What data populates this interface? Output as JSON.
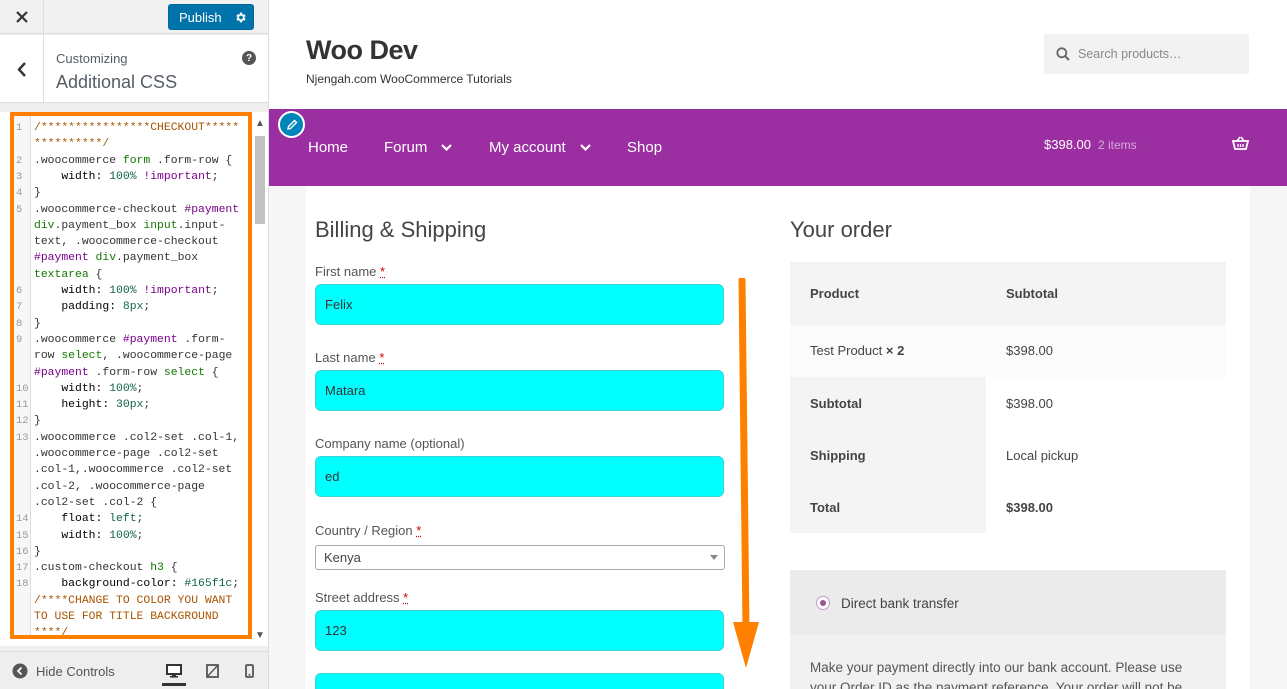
{
  "sidebar": {
    "publish_label": "Publish",
    "eyebrow": "Customizing",
    "title": "Additional CSS",
    "help": "?",
    "hide_controls": "Hide Controls",
    "code_lines": [
      {
        "n": "1",
        "parts": [
          [
            "c-com",
            "/****************CHECKOUT*****"
          ]
        ]
      },
      {
        "n": "",
        "parts": [
          [
            "c-com",
            "**********/"
          ]
        ]
      },
      {
        "n": "2",
        "parts": [
          [
            "",
            ".woocommerce "
          ],
          [
            "c-tag",
            "form"
          ],
          [
            "",
            " .form-row {"
          ]
        ]
      },
      {
        "n": "3",
        "parts": [
          [
            "c-prop",
            "    width: "
          ],
          [
            "c-val",
            "100%"
          ],
          [
            "c-imp",
            " !important"
          ],
          [
            "",
            ";"
          ]
        ]
      },
      {
        "n": "4",
        "parts": [
          [
            "",
            "}"
          ]
        ]
      },
      {
        "n": "5",
        "parts": [
          [
            "",
            ".woocommerce-checkout "
          ],
          [
            "c-imp",
            "#payment"
          ]
        ]
      },
      {
        "n": "",
        "parts": [
          [
            "c-tag",
            "div"
          ],
          [
            "",
            ".payment_box "
          ],
          [
            "c-tag",
            "input"
          ],
          [
            "",
            ".input-"
          ]
        ]
      },
      {
        "n": "",
        "parts": [
          [
            "",
            "text, .woocommerce-checkout"
          ]
        ]
      },
      {
        "n": "",
        "parts": [
          [
            "c-imp",
            "#payment"
          ],
          [
            "",
            " "
          ],
          [
            "c-tag",
            "div"
          ],
          [
            "",
            ".payment_box"
          ]
        ]
      },
      {
        "n": "",
        "parts": [
          [
            "c-tag",
            "textarea"
          ],
          [
            "",
            " {"
          ]
        ]
      },
      {
        "n": "6",
        "parts": [
          [
            "c-prop",
            "    width: "
          ],
          [
            "c-val",
            "100%"
          ],
          [
            "c-imp",
            " !important"
          ],
          [
            "",
            ";"
          ]
        ]
      },
      {
        "n": "7",
        "parts": [
          [
            "c-prop",
            "    padding: "
          ],
          [
            "c-val",
            "8px"
          ],
          [
            "",
            ";"
          ]
        ]
      },
      {
        "n": "8",
        "parts": [
          [
            "",
            "}"
          ]
        ]
      },
      {
        "n": "9",
        "parts": [
          [
            "",
            ".woocommerce "
          ],
          [
            "c-imp",
            "#payment"
          ],
          [
            "",
            " .form-"
          ]
        ]
      },
      {
        "n": "",
        "parts": [
          [
            "",
            "row "
          ],
          [
            "c-tag",
            "select"
          ],
          [
            "",
            ", .woocommerce-page"
          ]
        ]
      },
      {
        "n": "",
        "parts": [
          [
            "c-imp",
            "#payment"
          ],
          [
            "",
            " .form-row "
          ],
          [
            "c-tag",
            "select"
          ],
          [
            "",
            " {"
          ]
        ]
      },
      {
        "n": "10",
        "parts": [
          [
            "c-prop",
            "    width: "
          ],
          [
            "c-val",
            "100%"
          ],
          [
            "",
            ";"
          ]
        ]
      },
      {
        "n": "11",
        "parts": [
          [
            "c-prop",
            "    height: "
          ],
          [
            "c-val",
            "30px"
          ],
          [
            "",
            ";"
          ]
        ]
      },
      {
        "n": "12",
        "parts": [
          [
            "",
            "}"
          ]
        ]
      },
      {
        "n": "13",
        "parts": [
          [
            "",
            ".woocommerce .col2-set .col-1,"
          ]
        ]
      },
      {
        "n": "",
        "parts": [
          [
            "",
            ".woocommerce-page .col2-set"
          ]
        ]
      },
      {
        "n": "",
        "parts": [
          [
            "",
            ".col-1,.woocommerce .col2-set"
          ]
        ]
      },
      {
        "n": "",
        "parts": [
          [
            "",
            ".col-2, .woocommerce-page"
          ]
        ]
      },
      {
        "n": "",
        "parts": [
          [
            "",
            ".col2-set .col-2 {"
          ]
        ]
      },
      {
        "n": "14",
        "parts": [
          [
            "c-prop",
            "    float: "
          ],
          [
            "c-val",
            "left"
          ],
          [
            "",
            ";"
          ]
        ]
      },
      {
        "n": "15",
        "parts": [
          [
            "c-prop",
            "    width: "
          ],
          [
            "c-val",
            "100%"
          ],
          [
            "",
            ";"
          ]
        ]
      },
      {
        "n": "16",
        "parts": [
          [
            "",
            "}"
          ]
        ]
      },
      {
        "n": "17",
        "parts": [
          [
            "",
            ".custom-checkout "
          ],
          [
            "c-tag",
            "h3"
          ],
          [
            "",
            " {"
          ]
        ]
      },
      {
        "n": "18",
        "parts": [
          [
            "c-prop",
            "    background-color: "
          ],
          [
            "c-val",
            "#165f1c"
          ],
          [
            "",
            ";"
          ]
        ]
      },
      {
        "n": "",
        "parts": [
          [
            "c-com",
            "/****CHANGE TO COLOR YOU WANT"
          ]
        ]
      },
      {
        "n": "",
        "parts": [
          [
            "c-com",
            "TO USE FOR TITLE BACKGROUND"
          ]
        ]
      },
      {
        "n": "",
        "parts": [
          [
            "c-com",
            "****/"
          ]
        ]
      }
    ]
  },
  "site": {
    "title": "Woo Dev",
    "tagline": "Njengah.com WooCommerce Tutorials",
    "search_placeholder": "Search products…",
    "nav": [
      {
        "label": "Home",
        "has_sub": false
      },
      {
        "label": "Forum",
        "has_sub": true
      },
      {
        "label": "My account",
        "has_sub": true
      },
      {
        "label": "Shop",
        "has_sub": false
      }
    ],
    "cart_amount": "$398.00",
    "cart_count": "2 items"
  },
  "billing": {
    "heading": "Billing & Shipping",
    "first_name_label": "First name",
    "first_name_value": "Felix",
    "last_name_label": "Last name",
    "last_name_value": "Matara",
    "company_label": "Company name (optional)",
    "company_value": "ed",
    "country_label": "Country / Region",
    "country_value": "Kenya",
    "street_label": "Street address",
    "street_value": "123",
    "required_mark": "*"
  },
  "order": {
    "heading": "Your order",
    "col_product": "Product",
    "col_subtotal": "Subtotal",
    "item_name": "Test Product",
    "item_qty": "× 2",
    "item_total": "$398.00",
    "subtotal_label": "Subtotal",
    "subtotal_value": "$398.00",
    "shipping_label": "Shipping",
    "shipping_value": "Local pickup",
    "total_label": "Total",
    "total_value": "$398.00"
  },
  "payment": {
    "method": "Direct bank transfer",
    "description": "Make your payment directly into our bank account. Please use your Order ID as the payment reference. Your order will not be"
  },
  "colors": {
    "nav_bg": "#9b2fa2",
    "publish_bg": "#0073aa",
    "highlight_frame": "#ff7f00",
    "input_bg": "#00ffff",
    "arrow": "#ff7f00"
  },
  "icons": [
    "close-icon",
    "gear-icon",
    "chevron-left-icon",
    "help-icon",
    "hide-controls-icon",
    "desktop-icon",
    "tablet-icon",
    "mobile-icon",
    "search-icon",
    "pencil-icon",
    "chevron-down-icon",
    "cart-icon",
    "arrow-down-icon"
  ]
}
